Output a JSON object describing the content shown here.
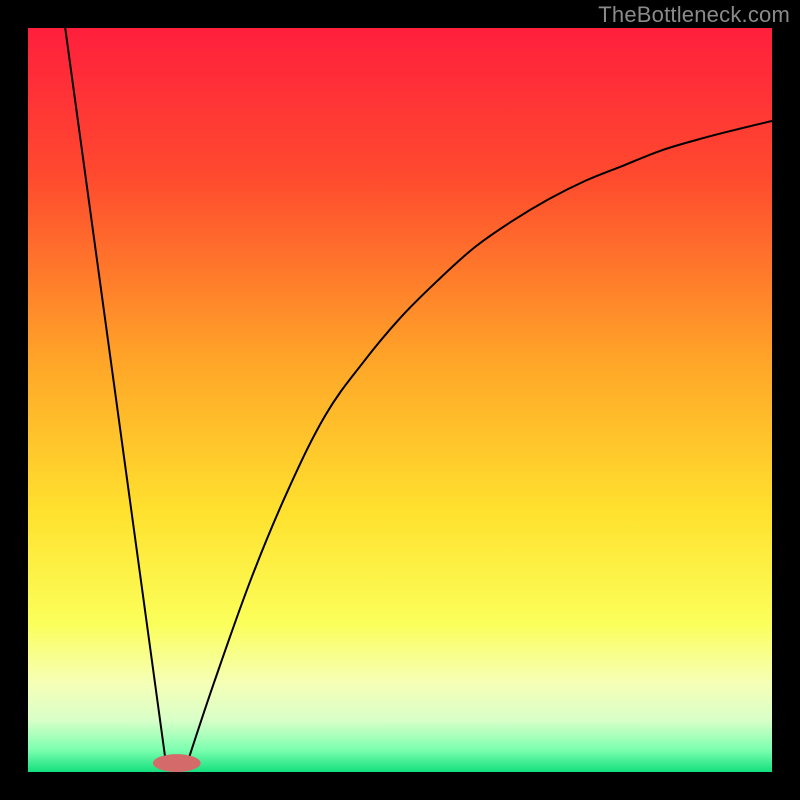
{
  "attribution": "TheBottleneck.com",
  "chart_data": {
    "type": "line",
    "title": "",
    "xlabel": "",
    "ylabel": "",
    "xlim": [
      0,
      100
    ],
    "ylim": [
      0,
      100
    ],
    "gradient_stops": [
      {
        "offset": 0,
        "color": "#ff1f3d"
      },
      {
        "offset": 20,
        "color": "#ff4a2e"
      },
      {
        "offset": 45,
        "color": "#ffa628"
      },
      {
        "offset": 65,
        "color": "#ffe12e"
      },
      {
        "offset": 80,
        "color": "#fbff5a"
      },
      {
        "offset": 88,
        "color": "#f6ffb6"
      },
      {
        "offset": 93,
        "color": "#d9ffc8"
      },
      {
        "offset": 97,
        "color": "#7dffb0"
      },
      {
        "offset": 100,
        "color": "#13e07e"
      }
    ],
    "curve_left": {
      "comment": "descending segment, roughly linear from top-left to dip",
      "x": [
        5,
        18.5
      ],
      "y": [
        100,
        1.5
      ]
    },
    "curve_right": {
      "comment": "ascending segment from dip, initially steep then flattening toward upper-right",
      "x": [
        21.5,
        25,
        30,
        35,
        40,
        45,
        50,
        55,
        60,
        65,
        70,
        75,
        80,
        85,
        90,
        95,
        100
      ],
      "y": [
        1.5,
        12,
        26,
        38,
        48,
        55,
        61,
        66,
        70.5,
        74,
        77,
        79.5,
        81.5,
        83.5,
        85,
        86.3,
        87.5
      ]
    },
    "dip_marker": {
      "x": 20,
      "y": 1.2,
      "rx": 3.2,
      "ry": 1.2,
      "color": "#d46a6a"
    },
    "line_color": "#000000",
    "line_width": 2.0
  }
}
